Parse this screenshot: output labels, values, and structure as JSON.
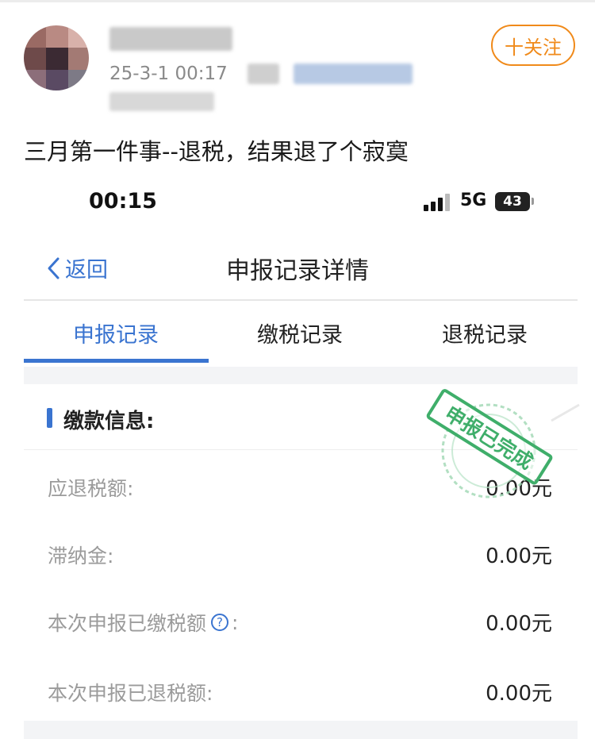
{
  "post": {
    "follow_label": "十关注",
    "timestamp": "25-3-1 00:17",
    "text": "三月第一件事--退税，结果退了个寂寞"
  },
  "statusbar": {
    "time": "00:15",
    "network": "5G",
    "battery": "43"
  },
  "nav": {
    "back_label": "返回",
    "title": "申报记录详情"
  },
  "tabs": [
    {
      "label": "申报记录",
      "active": true
    },
    {
      "label": "缴税记录",
      "active": false
    },
    {
      "label": "退税记录",
      "active": false
    }
  ],
  "section": {
    "title": "缴款信息:"
  },
  "rows": [
    {
      "label": "应退税额:",
      "value": "0.00元"
    },
    {
      "label": "滞纳金:",
      "value": "0.00元"
    },
    {
      "label": "本次申报已缴税额",
      "suffix": ":",
      "value": "0.00元",
      "help": true
    },
    {
      "label": "本次申报已退税额:",
      "value": "0.00元"
    }
  ],
  "stamp": {
    "text": "申报已完成",
    "color": "#3fae6a"
  },
  "colors": {
    "accent": "#3a74d0",
    "follow": "#f08a1a"
  }
}
